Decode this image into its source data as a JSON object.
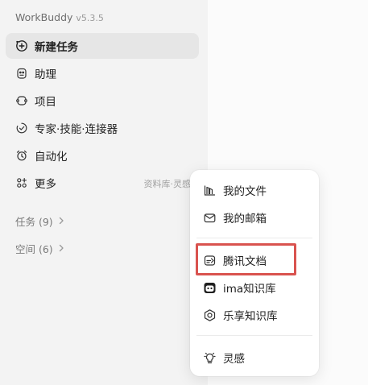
{
  "app": {
    "name": "WorkBuddy",
    "version": "v5.3.5"
  },
  "sidebar": {
    "items": [
      {
        "label": "新建任务",
        "icon": "plus-circle-icon",
        "active": true
      },
      {
        "label": "助理",
        "icon": "assistant-icon"
      },
      {
        "label": "项目",
        "icon": "project-icon"
      },
      {
        "label": "专家·技能·连接器",
        "icon": "skills-icon"
      },
      {
        "label": "自动化",
        "icon": "alarm-clock-icon"
      },
      {
        "label": "更多",
        "icon": "more-grid-icon",
        "hint": "资料库·灵感"
      }
    ],
    "sections": [
      {
        "label": "任务 (9)"
      },
      {
        "label": "空间 (6)"
      }
    ]
  },
  "popup": {
    "items": [
      {
        "label": "我的文件",
        "icon": "files-icon"
      },
      {
        "label": "我的邮箱",
        "icon": "mail-icon"
      },
      {
        "label": "腾讯文档",
        "icon": "tencent-docs-icon",
        "highlighted": true
      },
      {
        "label": "ima知识库",
        "icon": "ima-icon"
      },
      {
        "label": "乐享知识库",
        "icon": "lexiang-icon"
      },
      {
        "label": "灵感",
        "icon": "lightbulb-icon"
      }
    ]
  },
  "colors": {
    "highlight": "#d9534f",
    "sidebar_bg": "#f3f3f3",
    "active_bg": "#e6e6e6"
  }
}
